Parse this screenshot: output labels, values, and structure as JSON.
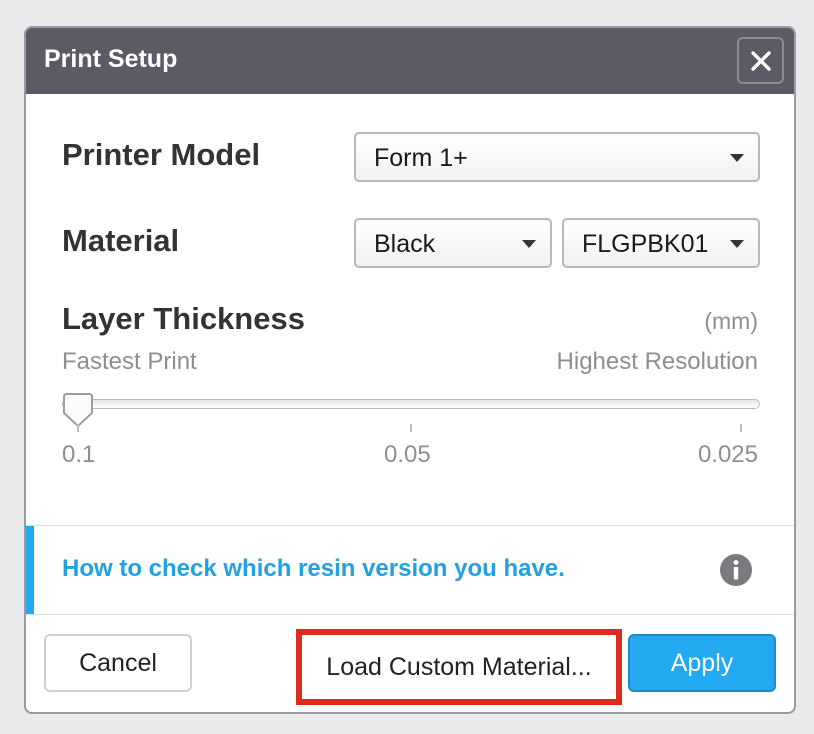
{
  "dialog": {
    "title": "Print Setup",
    "close_icon": "close-icon"
  },
  "printer_model": {
    "label": "Printer Model",
    "value": "Form 1+"
  },
  "material": {
    "label": "Material",
    "color_value": "Black",
    "code_value": "FLGPBK01"
  },
  "layer_thickness": {
    "label": "Layer Thickness",
    "unit": "(mm)",
    "left_hint": "Fastest Print",
    "right_hint": "Highest Resolution",
    "ticks": [
      "0.1",
      "0.05",
      "0.025"
    ],
    "selected": "0.1"
  },
  "info": {
    "link_text": "How to check which resin version you have.",
    "icon": "info-icon",
    "accent_color": "#21a8ef"
  },
  "footer": {
    "cancel_label": "Cancel",
    "load_label": "Load Custom Material...",
    "apply_label": "Apply",
    "apply_color": "#23a9ef",
    "highlight_color": "#dd2b1d"
  }
}
